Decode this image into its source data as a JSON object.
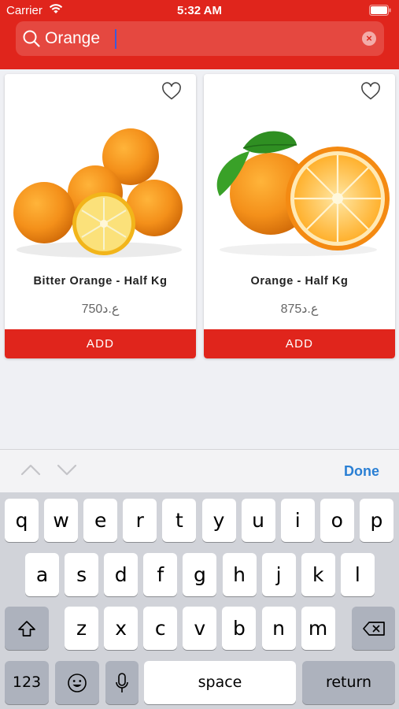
{
  "status_bar": {
    "carrier": "Carrier",
    "time": "5:32 AM"
  },
  "search": {
    "value": "Orange"
  },
  "products": [
    {
      "name": "Bitter Orange - Half Kg",
      "price": "ع.د750",
      "add_label": "ADD",
      "image_icon": "bitter-oranges-image"
    },
    {
      "name": "Orange - Half Kg",
      "price": "ع.د875",
      "add_label": "ADD",
      "image_icon": "orange-image"
    }
  ],
  "accessory": {
    "done_label": "Done"
  },
  "keyboard": {
    "row1": [
      "q",
      "w",
      "e",
      "r",
      "t",
      "y",
      "u",
      "i",
      "o",
      "p"
    ],
    "row2": [
      "a",
      "s",
      "d",
      "f",
      "g",
      "h",
      "j",
      "k",
      "l"
    ],
    "row3": [
      "z",
      "x",
      "c",
      "v",
      "b",
      "n",
      "m"
    ],
    "numbers_label": "123",
    "space_label": "space",
    "return_label": "return"
  },
  "colors": {
    "brand": "#e0251c",
    "link": "#2a7fd4"
  }
}
